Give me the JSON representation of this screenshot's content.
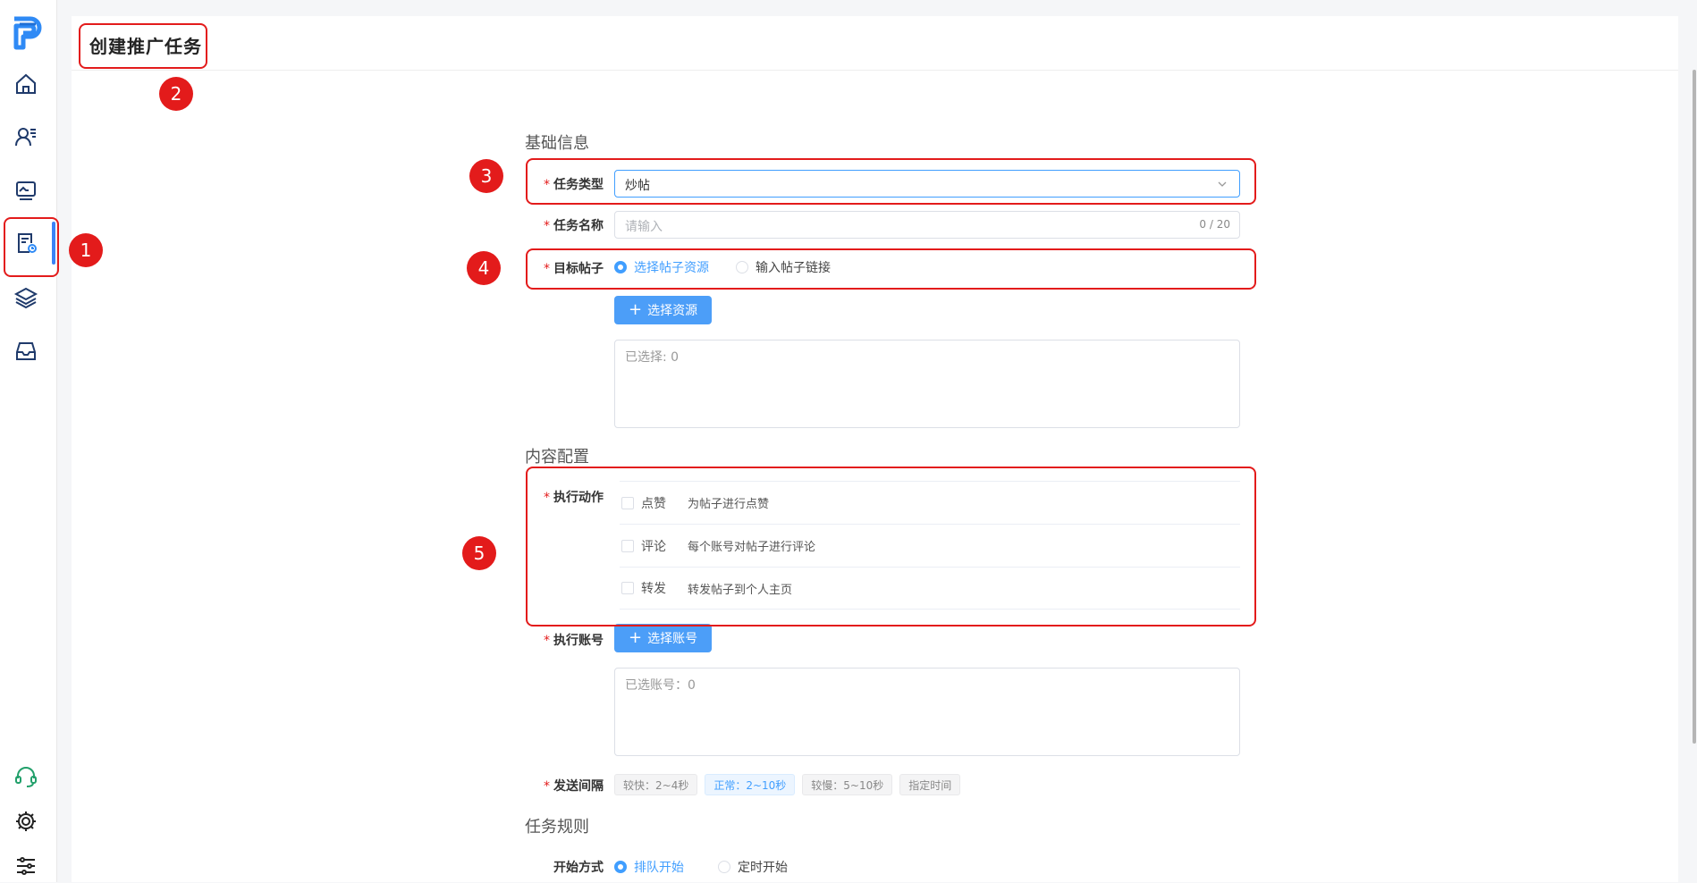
{
  "page": {
    "title": "创建推广任务"
  },
  "annotations": [
    "1",
    "2",
    "3",
    "4",
    "5"
  ],
  "sidebar": {
    "items": [
      {
        "icon": "home-icon"
      },
      {
        "icon": "user-list-icon"
      },
      {
        "icon": "monitor-icon"
      },
      {
        "icon": "task-doc-icon"
      },
      {
        "icon": "layers-icon"
      },
      {
        "icon": "inbox-icon"
      },
      {
        "icon": "headset-icon"
      },
      {
        "icon": "gear-icon"
      },
      {
        "icon": "sliders-icon"
      }
    ],
    "active_index": 3
  },
  "form": {
    "basic_section": "基础信息",
    "task_type": {
      "label": "任务类型",
      "value": "炒帖"
    },
    "task_name": {
      "label": "任务名称",
      "placeholder": "请输入",
      "counter": "0 / 20"
    },
    "target_post": {
      "label": "目标帖子",
      "options": [
        "选择帖子资源",
        "输入帖子链接"
      ],
      "selected": "选择帖子资源"
    },
    "select_resource_button": "选择资源",
    "selected_resources": "已选择: 0",
    "content_section": "内容配置",
    "actions": {
      "label": "执行动作",
      "items": [
        {
          "name": "点赞",
          "desc": "为帖子进行点赞"
        },
        {
          "name": "评论",
          "desc": "每个账号对帖子进行评论"
        },
        {
          "name": "转发",
          "desc": "转发帖子到个人主页"
        }
      ]
    },
    "account": {
      "label": "执行账号",
      "button": "选择账号",
      "selected": "已选账号：0"
    },
    "interval": {
      "label": "发送间隔",
      "options": [
        "较快：2~4秒",
        "正常：2~10秒",
        "较慢：5~10秒",
        "指定时间"
      ],
      "selected": "正常：2~10秒"
    },
    "rules_section": "任务规则",
    "start_mode": {
      "label": "开始方式",
      "options": [
        "排队开始",
        "定时开始"
      ],
      "selected": "排队开始"
    }
  },
  "colors": {
    "accent": "#409eff",
    "annotation": "#e31b1b",
    "required": "#e31b1b"
  }
}
